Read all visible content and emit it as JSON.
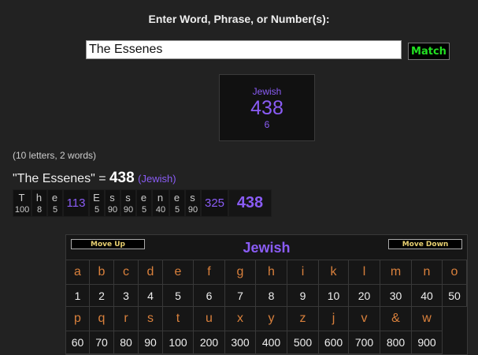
{
  "prompt": "Enter Word, Phrase, or Number(s):",
  "input": {
    "value": "The Essenes"
  },
  "match_label": "Match",
  "result_box": {
    "cipher": "Jewish",
    "value": "438",
    "reduction": "6"
  },
  "stats": "(10 letters, 2 words)",
  "summary": {
    "phrase": "\"The Essenes\" = ",
    "value": "438",
    "cipher": "(Jewish)"
  },
  "breakdown": {
    "words": [
      {
        "letters": [
          {
            "l": "T",
            "n": "100"
          },
          {
            "l": "h",
            "n": "8"
          },
          {
            "l": "e",
            "n": "5"
          }
        ],
        "total": "113"
      },
      {
        "letters": [
          {
            "l": "E",
            "n": "5"
          },
          {
            "l": "s",
            "n": "90"
          },
          {
            "l": "s",
            "n": "90"
          },
          {
            "l": "e",
            "n": "5"
          },
          {
            "l": "n",
            "n": "40"
          },
          {
            "l": "e",
            "n": "5"
          },
          {
            "l": "s",
            "n": "90"
          }
        ],
        "total": "325"
      }
    ],
    "grand_total": "438"
  },
  "cipher_table": {
    "move_up": "Move Up",
    "move_down": "Move Down",
    "name": "Jewish",
    "rows": [
      [
        [
          "a",
          "1"
        ],
        [
          "b",
          "2"
        ],
        [
          "c",
          "3"
        ],
        [
          "d",
          "4"
        ],
        [
          "e",
          "5"
        ],
        [
          "f",
          "6"
        ],
        [
          "g",
          "7"
        ],
        [
          "h",
          "8"
        ],
        [
          "i",
          "9"
        ],
        [
          "k",
          "10"
        ],
        [
          "l",
          "20"
        ],
        [
          "m",
          "30"
        ],
        [
          "n",
          "40"
        ],
        [
          "o",
          "50"
        ]
      ],
      [
        [
          "p",
          "60"
        ],
        [
          "q",
          "70"
        ],
        [
          "r",
          "80"
        ],
        [
          "s",
          "90"
        ],
        [
          "t",
          "100"
        ],
        [
          "u",
          "200"
        ],
        [
          "x",
          "300"
        ],
        [
          "y",
          "400"
        ],
        [
          "z",
          "500"
        ],
        [
          "j",
          "600"
        ],
        [
          "v",
          "700"
        ],
        [
          "&",
          "800"
        ],
        [
          "w",
          "900"
        ]
      ]
    ]
  },
  "colors": {
    "background": "#222222",
    "cipher": "#8a5cf5",
    "letters": "#d9803c",
    "match": "#22e022"
  }
}
